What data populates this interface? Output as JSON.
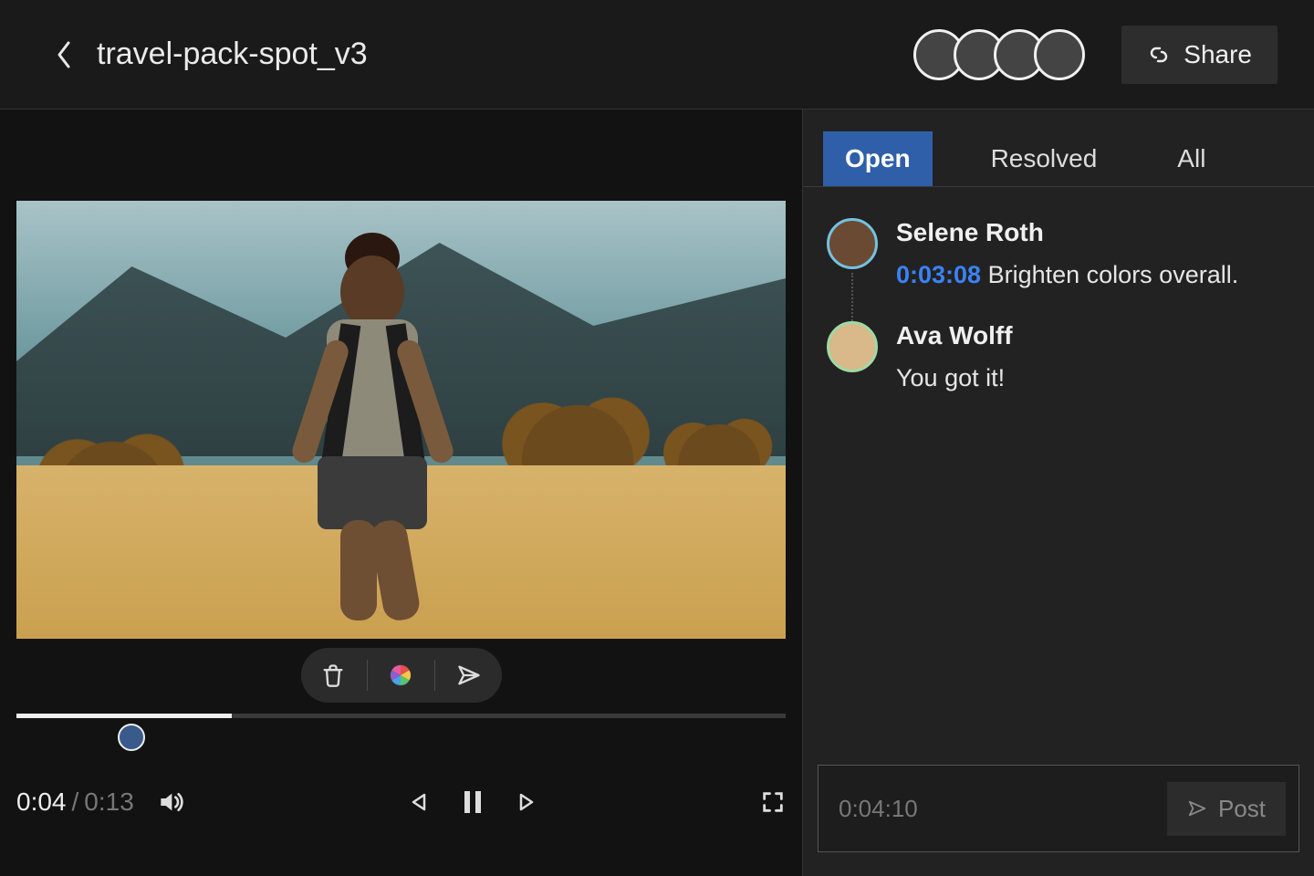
{
  "header": {
    "file_title": "travel-pack-spot_v3",
    "share_label": "Share",
    "avatars": [
      {
        "ring": "#74c2e1"
      },
      {
        "ring": "#9fd9a3"
      },
      {
        "ring": "#bfe0f2"
      },
      {
        "ring": "#e49a3a"
      }
    ]
  },
  "player": {
    "current": "0:04",
    "separator": "/",
    "duration": "0:13",
    "progress_pct": 28,
    "marker_pct": 15
  },
  "tabs": {
    "open": "Open",
    "resolved": "Resolved",
    "all": "All",
    "active": "open"
  },
  "comments": [
    {
      "author": "Selene Roth",
      "timestamp": "0:03:08",
      "text": "Brighten colors overall.",
      "avatar_ring": "#74c2e1",
      "has_reply_rail": true
    },
    {
      "author": "Ava Wolff",
      "timestamp": "",
      "text": "You got it!",
      "avatar_ring": "#9fd9a3",
      "has_reply_rail": false
    }
  ],
  "composer": {
    "placeholder": "0:04:10",
    "post_label": "Post"
  }
}
